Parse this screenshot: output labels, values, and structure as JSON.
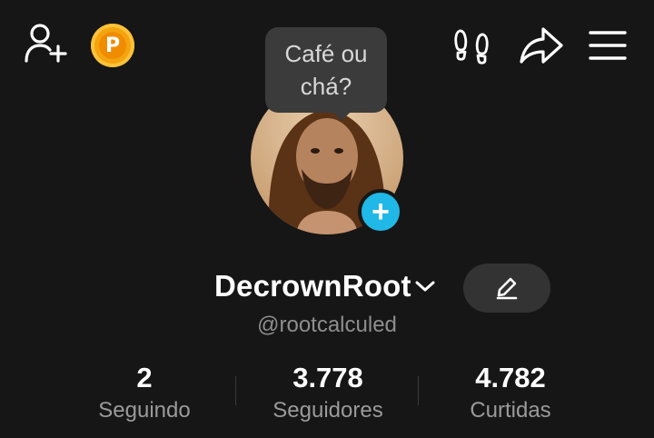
{
  "header": {
    "add_friend_icon": "person-plus-icon",
    "coin_icon": "coin-icon",
    "coin_letter": "P",
    "footprints_icon": "footprints-icon",
    "share_icon": "share-icon",
    "menu_icon": "menu-icon"
  },
  "tooltip": {
    "line1": "Café ou",
    "line2": "chá?"
  },
  "profile": {
    "add_badge": "+",
    "username": "DecrownRoot",
    "handle": "@rootcalculed"
  },
  "stats": [
    {
      "value": "2",
      "label": "Seguindo"
    },
    {
      "value": "3.778",
      "label": "Seguidores"
    },
    {
      "value": "4.782",
      "label": "Curtidas"
    }
  ],
  "colors": {
    "background": "#161616",
    "accent_badge": "#20b8e6",
    "coin": "#f4a40f"
  }
}
